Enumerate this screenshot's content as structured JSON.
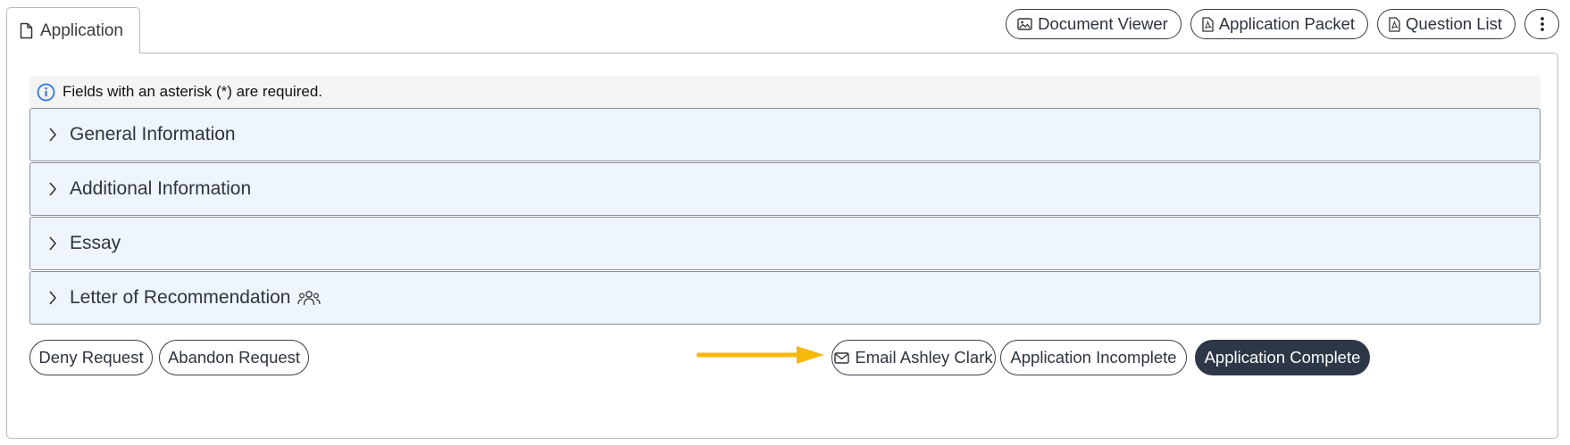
{
  "tab": {
    "label": "Application",
    "icon": "file-icon"
  },
  "toolbar": {
    "document_viewer": "Document Viewer",
    "application_packet": "Application Packet",
    "question_list": "Question List"
  },
  "notice": {
    "text": "Fields with an asterisk (*) are required."
  },
  "sections": [
    {
      "label": "General Information"
    },
    {
      "label": "Additional Information"
    },
    {
      "label": "Essay"
    },
    {
      "label": "Letter of Recommendation"
    }
  ],
  "actions": {
    "deny": "Deny Request",
    "abandon": "Abandon Request",
    "email": "Email Ashley Clark",
    "incomplete": "Application Incomplete",
    "complete": "Application Complete"
  },
  "colors": {
    "section_bg": "#eef5fd",
    "primary_dark": "#2d3748",
    "info_blue": "#2a7ae2",
    "arrow": "#f6b80b"
  }
}
